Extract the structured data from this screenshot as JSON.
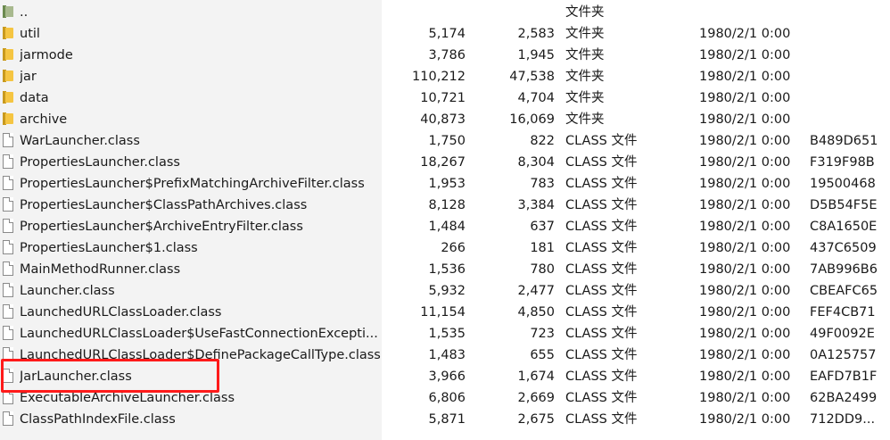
{
  "rows": [
    {
      "name": "..",
      "size": "",
      "packed": "",
      "type": "文件夹",
      "modified": "",
      "crc": "",
      "icon": "folder-up-icon"
    },
    {
      "name": "util",
      "size": "5,174",
      "packed": "2,583",
      "type": "文件夹",
      "modified": "1980/2/1 0:00",
      "crc": "",
      "icon": "folder-icon"
    },
    {
      "name": "jarmode",
      "size": "3,786",
      "packed": "1,945",
      "type": "文件夹",
      "modified": "1980/2/1 0:00",
      "crc": "",
      "icon": "folder-icon"
    },
    {
      "name": "jar",
      "size": "110,212",
      "packed": "47,538",
      "type": "文件夹",
      "modified": "1980/2/1 0:00",
      "crc": "",
      "icon": "folder-icon"
    },
    {
      "name": "data",
      "size": "10,721",
      "packed": "4,704",
      "type": "文件夹",
      "modified": "1980/2/1 0:00",
      "crc": "",
      "icon": "folder-icon"
    },
    {
      "name": "archive",
      "size": "40,873",
      "packed": "16,069",
      "type": "文件夹",
      "modified": "1980/2/1 0:00",
      "crc": "",
      "icon": "folder-icon"
    },
    {
      "name": "WarLauncher.class",
      "size": "1,750",
      "packed": "822",
      "type": "CLASS 文件",
      "modified": "1980/2/1 0:00",
      "crc": "B489D651",
      "icon": "file-icon"
    },
    {
      "name": "PropertiesLauncher.class",
      "size": "18,267",
      "packed": "8,304",
      "type": "CLASS 文件",
      "modified": "1980/2/1 0:00",
      "crc": "F319F98B",
      "icon": "file-icon"
    },
    {
      "name": "PropertiesLauncher$PrefixMatchingArchiveFilter.class",
      "size": "1,953",
      "packed": "783",
      "type": "CLASS 文件",
      "modified": "1980/2/1 0:00",
      "crc": "19500468",
      "icon": "file-icon"
    },
    {
      "name": "PropertiesLauncher$ClassPathArchives.class",
      "size": "8,128",
      "packed": "3,384",
      "type": "CLASS 文件",
      "modified": "1980/2/1 0:00",
      "crc": "D5B54F5E",
      "icon": "file-icon"
    },
    {
      "name": "PropertiesLauncher$ArchiveEntryFilter.class",
      "size": "1,484",
      "packed": "637",
      "type": "CLASS 文件",
      "modified": "1980/2/1 0:00",
      "crc": "C8A1650E",
      "icon": "file-icon"
    },
    {
      "name": "PropertiesLauncher$1.class",
      "size": "266",
      "packed": "181",
      "type": "CLASS 文件",
      "modified": "1980/2/1 0:00",
      "crc": "437C6509",
      "icon": "file-icon"
    },
    {
      "name": "MainMethodRunner.class",
      "size": "1,536",
      "packed": "780",
      "type": "CLASS 文件",
      "modified": "1980/2/1 0:00",
      "crc": "7AB996B6",
      "icon": "file-icon"
    },
    {
      "name": "Launcher.class",
      "size": "5,932",
      "packed": "2,477",
      "type": "CLASS 文件",
      "modified": "1980/2/1 0:00",
      "crc": "CBEAFC65",
      "icon": "file-icon"
    },
    {
      "name": "LaunchedURLClassLoader.class",
      "size": "11,154",
      "packed": "4,850",
      "type": "CLASS 文件",
      "modified": "1980/2/1 0:00",
      "crc": "FEF4CB71",
      "icon": "file-icon"
    },
    {
      "name": "LaunchedURLClassLoader$UseFastConnectionExcepti...",
      "size": "1,535",
      "packed": "723",
      "type": "CLASS 文件",
      "modified": "1980/2/1 0:00",
      "crc": "49F0092E",
      "icon": "file-icon"
    },
    {
      "name": "LaunchedURLClassLoader$DefinePackageCallType.class",
      "size": "1,483",
      "packed": "655",
      "type": "CLASS 文件",
      "modified": "1980/2/1 0:00",
      "crc": "0A125757",
      "icon": "file-icon"
    },
    {
      "name": "JarLauncher.class",
      "size": "3,966",
      "packed": "1,674",
      "type": "CLASS 文件",
      "modified": "1980/2/1 0:00",
      "crc": "EAFD7B1F",
      "icon": "file-icon"
    },
    {
      "name": "ExecutableArchiveLauncher.class",
      "size": "6,806",
      "packed": "2,669",
      "type": "CLASS 文件",
      "modified": "1980/2/1 0:00",
      "crc": "62BA2499",
      "icon": "file-icon"
    },
    {
      "name": "ClassPathIndexFile.class",
      "size": "5,871",
      "packed": "2,675",
      "type": "CLASS 文件",
      "modified": "1980/2/1 0:00",
      "crc": "712DD9...",
      "icon": "file-icon"
    }
  ],
  "annotation": {
    "highlighted_row_name": "JarLauncher.class",
    "color": "#ff1a1a"
  }
}
